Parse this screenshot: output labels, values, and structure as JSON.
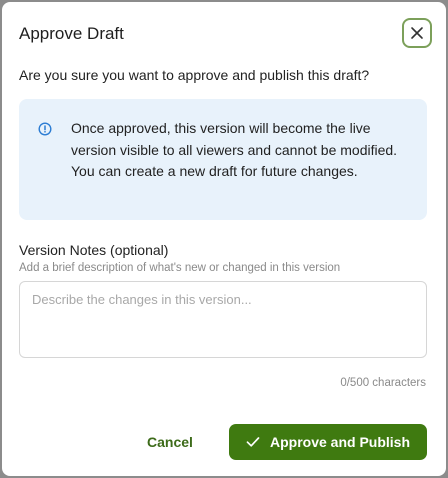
{
  "dialog": {
    "title": "Approve Draft",
    "close_icon": "close-icon",
    "question": "Are you sure you want to approve and publish this draft?",
    "info": {
      "icon": "info-icon",
      "text": "Once approved, this version will become the live version visible to all viewers and cannot be modified. You can create a new draft for future changes."
    },
    "notes": {
      "label": "Version Notes (optional)",
      "hint": "Add a brief description of what's new or changed in this version",
      "placeholder": "Describe the changes in this version...",
      "value": "",
      "char_count": "0/500 characters"
    },
    "buttons": {
      "cancel_label": "Cancel",
      "approve_label": "Approve and Publish",
      "approve_icon": "check-icon"
    }
  },
  "colors": {
    "accent": "#3f7a10",
    "accent_text": "#3d6b1a",
    "info_bg": "#e8f2fb",
    "info_icon": "#2b7cd3",
    "close_border": "#7ca05a",
    "backdrop": "#8c8c8c"
  }
}
